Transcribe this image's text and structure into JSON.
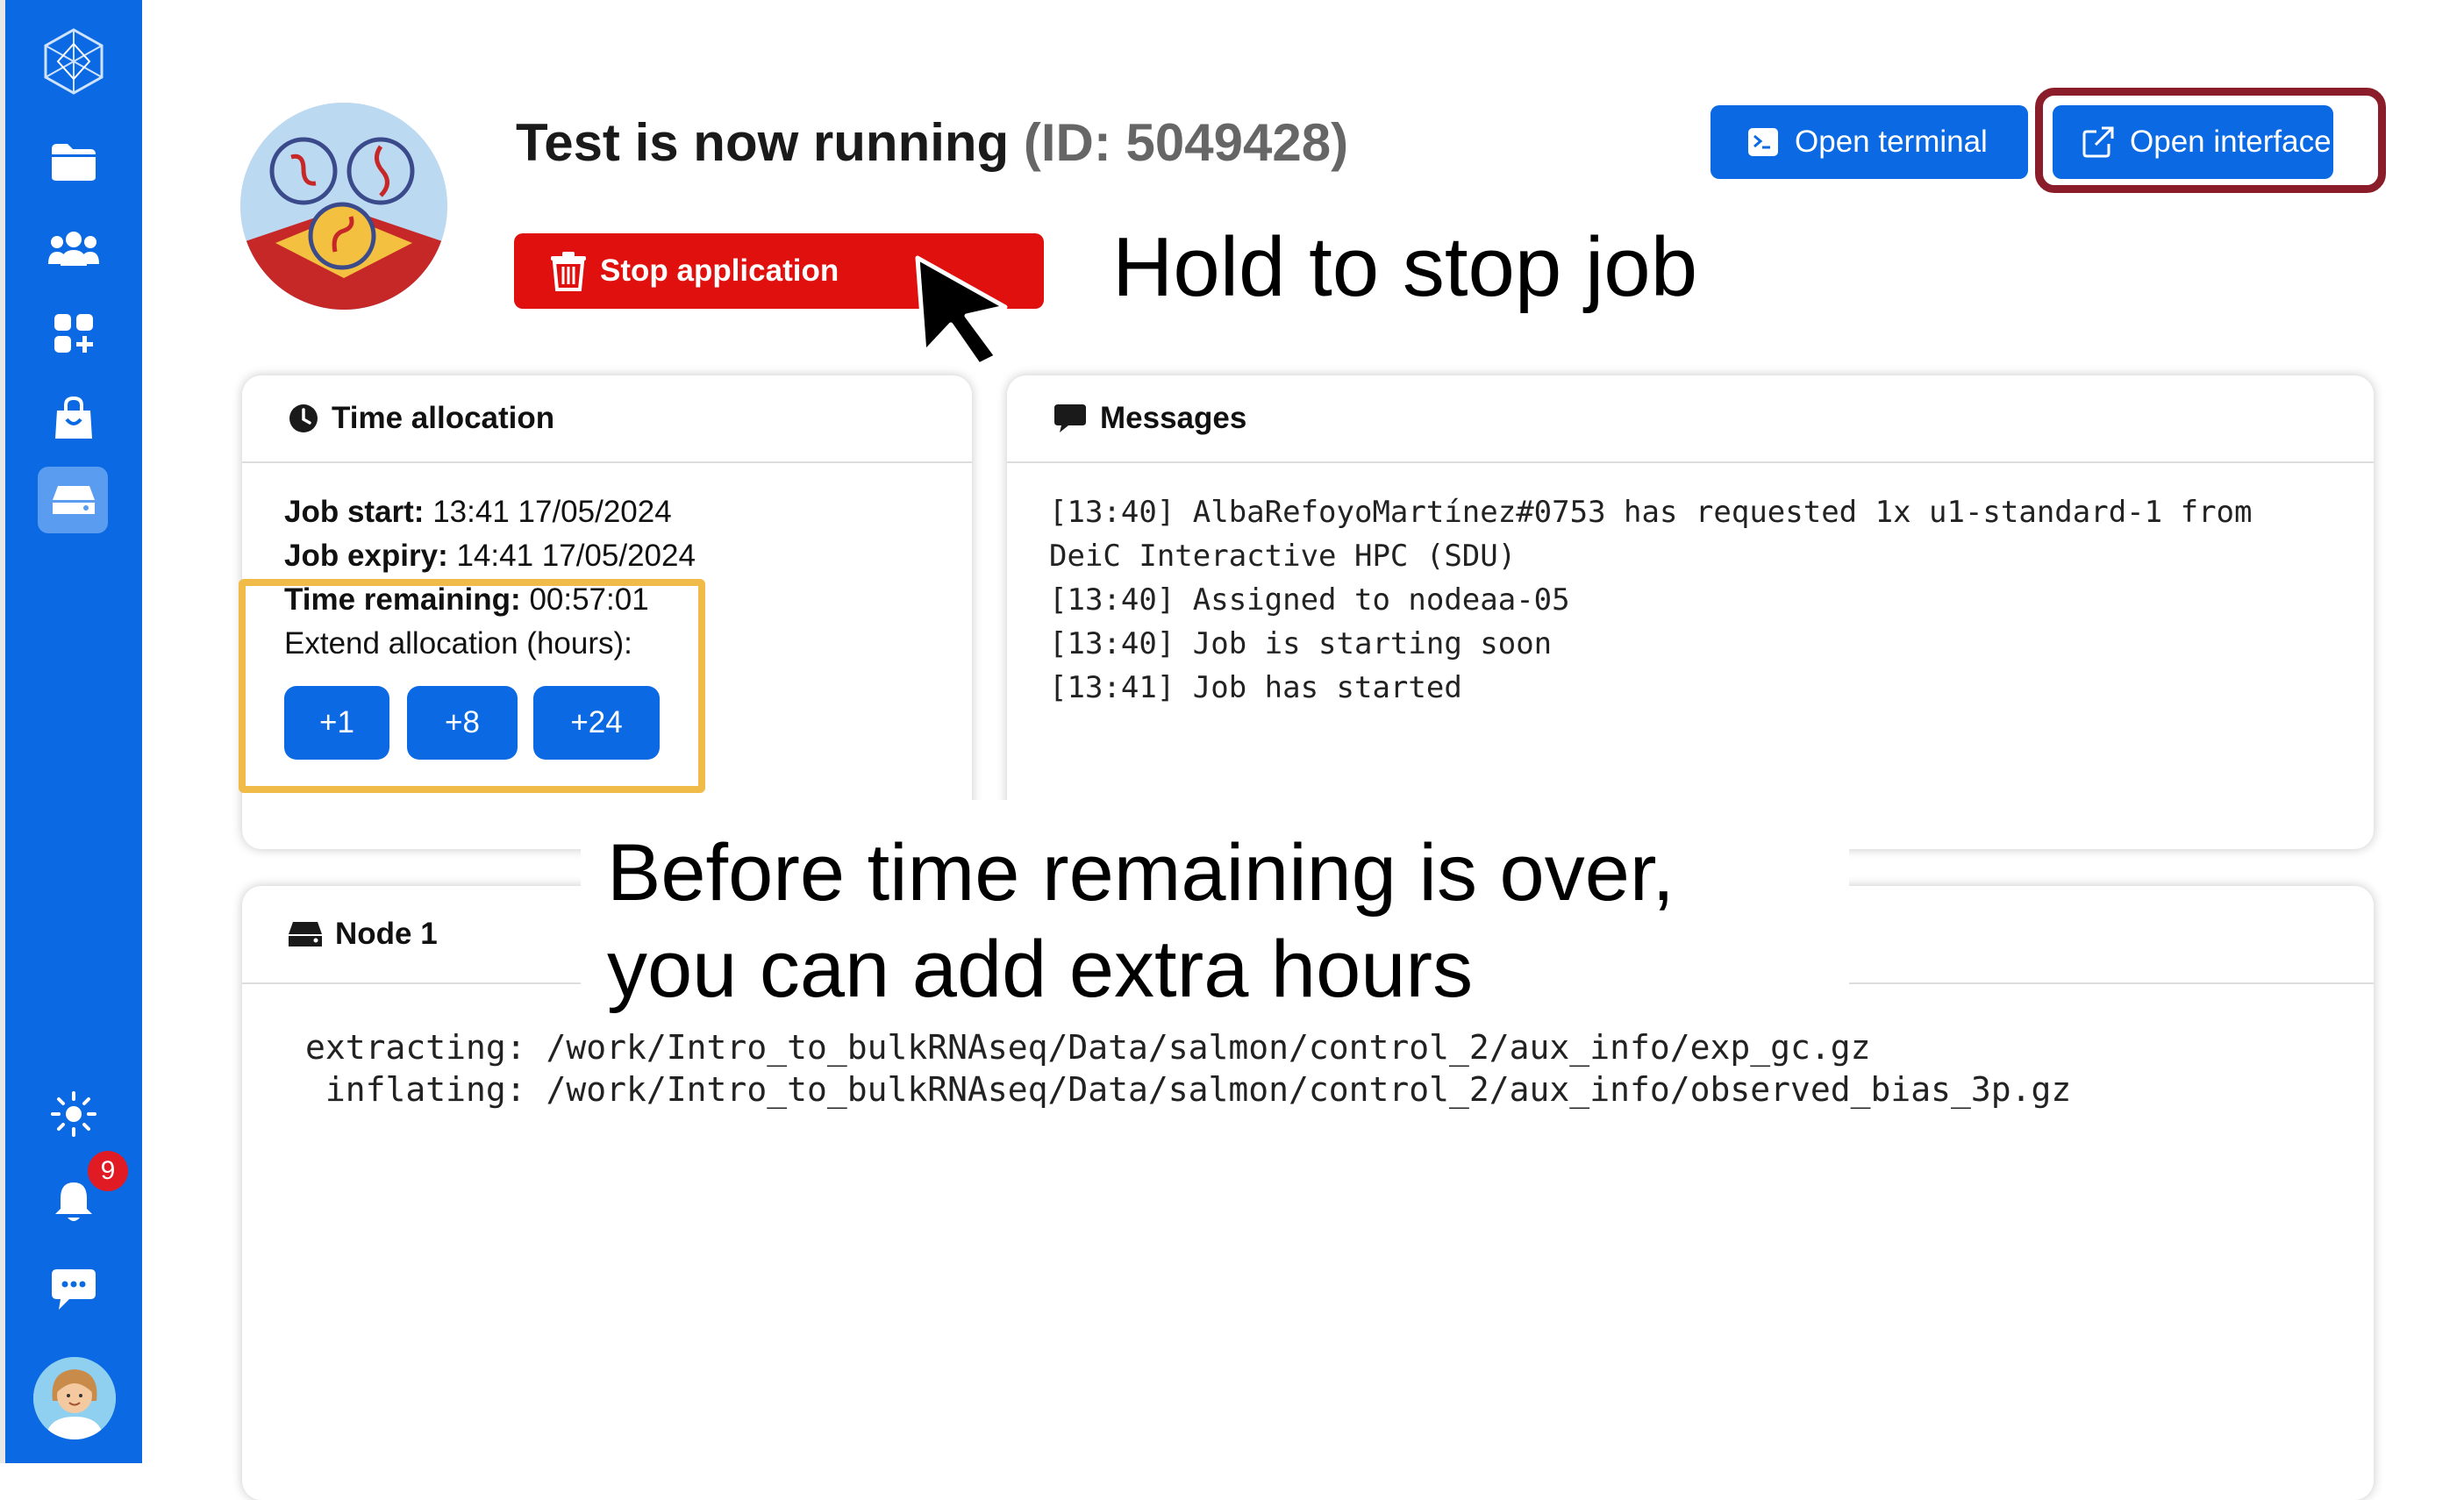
{
  "sidebar": {
    "items": [
      {
        "icon": "folder-icon"
      },
      {
        "icon": "users-icon"
      },
      {
        "icon": "apps-add-icon"
      },
      {
        "icon": "shopping-bag-icon"
      },
      {
        "icon": "drive-icon",
        "active": true
      }
    ],
    "bottom": [
      {
        "icon": "sun-icon"
      },
      {
        "icon": "bell-icon",
        "badge": "9"
      },
      {
        "icon": "chat-icon"
      },
      {
        "icon": "user-avatar"
      }
    ]
  },
  "header": {
    "title": "Test is now running",
    "id_text": "(ID: 5049428)",
    "stop_label": "Stop application",
    "terminal_label": "Open terminal",
    "interface_label": "Open interface"
  },
  "annotations": {
    "stop": "Hold to stop job",
    "extend_line1": "Before time remaining is over,",
    "extend_line2": "you can add extra hours"
  },
  "time_allocation": {
    "title": "Time allocation",
    "job_start_label": "Job start:",
    "job_start_value": "13:41 17/05/2024",
    "job_expiry_label": "Job expiry:",
    "job_expiry_value": "14:41 17/05/2024",
    "remaining_label": "Time remaining:",
    "remaining_value": "00:57:01",
    "extend_label": "Extend allocation (hours):",
    "extend_buttons": [
      "+1",
      "+8",
      "+24"
    ]
  },
  "messages": {
    "title": "Messages",
    "lines": [
      "[13:40] AlbaRefoyoMartínez#0753 has requested 1x u1-standard-1 from",
      "DeiC Interactive HPC (SDU)",
      "[13:40] Assigned to nodeaa-05",
      "[13:40] Job is starting soon",
      "[13:41] Job has started"
    ]
  },
  "node": {
    "title": "Node 1",
    "lines": [
      "extracting: /work/Intro_to_bulkRNAseq/Data/salmon/control_2/aux_info/exp_gc.gz",
      " inflating: /work/Intro_to_bulkRNAseq/Data/salmon/control_2/aux_info/observed_bias_3p.gz"
    ]
  },
  "colors": {
    "primary": "#0b69e3",
    "danger": "#e0100f",
    "highlight_interface": "#8b1d2a",
    "highlight_extend": "#f1bb4a"
  }
}
